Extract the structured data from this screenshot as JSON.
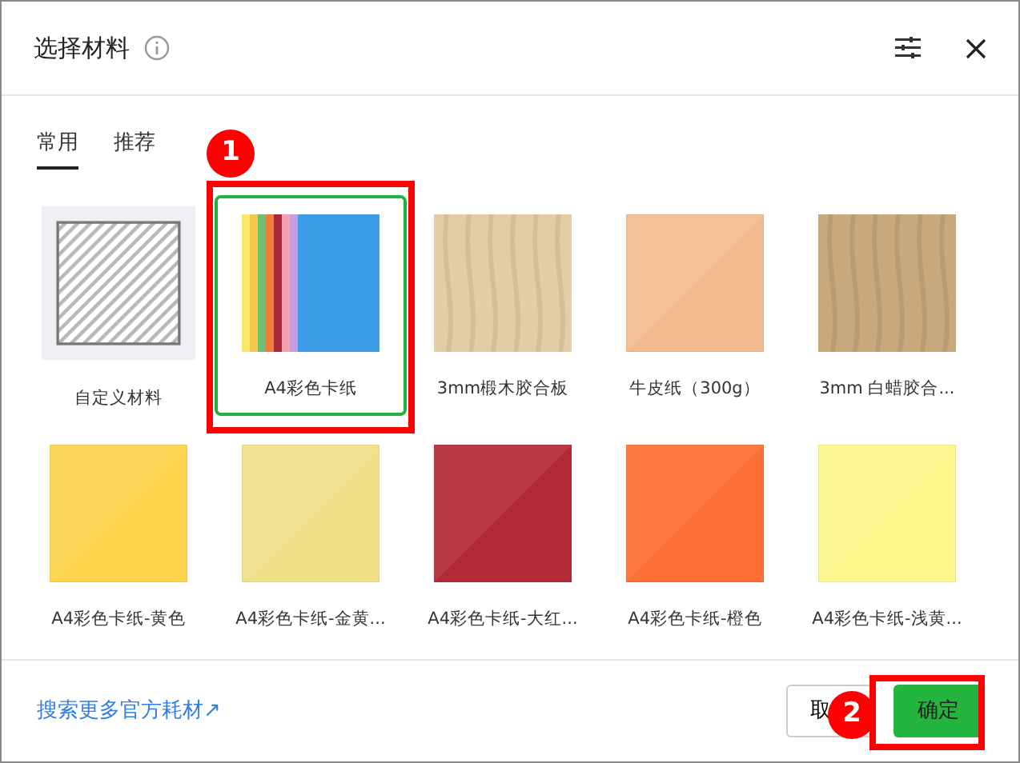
{
  "dialog": {
    "title": "选择材料"
  },
  "tabs": [
    {
      "label": "常用",
      "selected": true
    },
    {
      "label": "推荐",
      "selected": false
    }
  ],
  "materials": [
    {
      "label": "自定义材料",
      "kind": "custom",
      "selected": false
    },
    {
      "label": "A4彩色卡纸",
      "kind": "stripes",
      "selected": true
    },
    {
      "label": "3mm椴木胶合板",
      "kind": "wood",
      "color": "#e3cda6",
      "selected": false
    },
    {
      "label": "牛皮纸（300g）",
      "kind": "plain",
      "color": "#f2bb8f",
      "selected": false
    },
    {
      "label": "3mm 白蜡胶合...",
      "kind": "wood",
      "color": "#c9a87c",
      "selected": false
    },
    {
      "label": "A4彩色卡纸-黄色",
      "kind": "plain",
      "color": "#fdd44c",
      "selected": false
    },
    {
      "label": "A4彩色卡纸-金黄...",
      "kind": "plain",
      "color": "#f0e08a",
      "selected": false
    },
    {
      "label": "A4彩色卡纸-大红...",
      "kind": "plain",
      "color": "#b52a36",
      "selected": false
    },
    {
      "label": "A4彩色卡纸-橙色",
      "kind": "plain",
      "color": "#fe6e35",
      "selected": false
    },
    {
      "label": "A4彩色卡纸-浅黄...",
      "kind": "plain",
      "color": "#fcf78b",
      "selected": false
    }
  ],
  "footer": {
    "link": "搜索更多官方耗材↗",
    "cancel": "取",
    "confirm": "确定"
  },
  "annotations": [
    {
      "text": "1"
    },
    {
      "text": "2"
    }
  ]
}
